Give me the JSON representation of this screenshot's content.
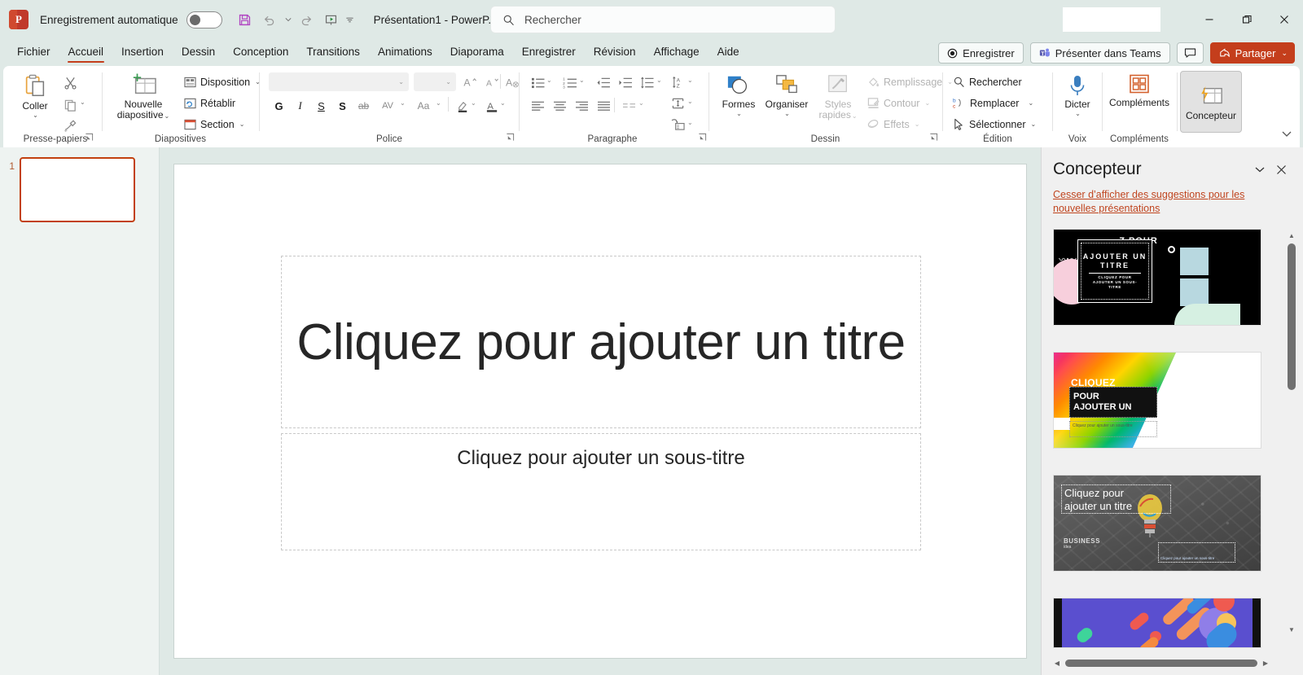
{
  "titlebar": {
    "app_logo": "powerpoint-logo",
    "autosave_label": "Enregistrement automatique",
    "autosave_state": "off",
    "quick_access": [
      {
        "name": "save-icon",
        "label": "Enregistrer"
      },
      {
        "name": "undo-icon",
        "label": "Annuler"
      },
      {
        "name": "redo-icon",
        "label": "Rétablir"
      },
      {
        "name": "start-slideshow-icon",
        "label": "Démarrer à partir du début"
      },
      {
        "name": "customize-qat-icon",
        "label": "Personnaliser la barre d'outils Accès rapide"
      }
    ],
    "document_title": "Présentation1  -  PowerP...",
    "window_controls": {
      "minimize": "–",
      "restore": "❐",
      "close": "✕"
    }
  },
  "search": {
    "placeholder": "Rechercher",
    "icon": "search-icon"
  },
  "tabs": [
    {
      "label": "Fichier",
      "active": false
    },
    {
      "label": "Accueil",
      "active": true
    },
    {
      "label": "Insertion",
      "active": false
    },
    {
      "label": "Dessin",
      "active": false
    },
    {
      "label": "Conception",
      "active": false
    },
    {
      "label": "Transitions",
      "active": false
    },
    {
      "label": "Animations",
      "active": false
    },
    {
      "label": "Diaporama",
      "active": false
    },
    {
      "label": "Enregistrer",
      "active": false
    },
    {
      "label": "Révision",
      "active": false
    },
    {
      "label": "Affichage",
      "active": false
    },
    {
      "label": "Aide",
      "active": false
    }
  ],
  "tab_actions": {
    "record_label": "Enregistrer",
    "teams_label": "Présenter dans Teams",
    "comments_label": "Commentaires",
    "share_label": "Partager"
  },
  "ribbon": {
    "groups": [
      {
        "name": "presse-papiers",
        "label": "Presse-papiers"
      },
      {
        "name": "diapositives",
        "label": "Diapositives"
      },
      {
        "name": "police",
        "label": "Police"
      },
      {
        "name": "paragraphe",
        "label": "Paragraphe"
      },
      {
        "name": "dessin",
        "label": "Dessin"
      },
      {
        "name": "edition",
        "label": "Édition"
      },
      {
        "name": "voix",
        "label": "Voix"
      },
      {
        "name": "complements",
        "label": "Compléments"
      }
    ],
    "clipboard": {
      "paste_label": "Coller",
      "cut_label": "Couper",
      "copy_label": "Copier",
      "format_painter_label": "Reproduire la mise en forme"
    },
    "slides": {
      "new_slide_line1": "Nouvelle",
      "new_slide_line2": "diapositive",
      "layout_label": "Disposition",
      "reset_label": "Rétablir",
      "section_label": "Section"
    },
    "font": {
      "font_name_value": "",
      "font_size_value": "",
      "grow_label": "Augmenter la taille de police",
      "shrink_label": "Diminuer la taille de police",
      "clear_format_label": "Effacer toute la mise en forme",
      "bold_label": "G",
      "italic_label": "I",
      "underline_label": "S",
      "shadow_label": "S",
      "strike_label": "ab",
      "spacing_label": "AV",
      "case_label": "Aa",
      "highlight_label": "Couleur de surbrillance du texte",
      "fontcolor_label": "Couleur de police"
    },
    "paragraph": {
      "bullets_label": "Puces",
      "numbering_label": "Numérotation",
      "decrease_indent_label": "Diminuer le retrait",
      "increase_indent_label": "Augmenter le retrait",
      "line_spacing_label": "Interligne",
      "align_left_label": "Aligner à gauche",
      "align_center_label": "Centrer",
      "align_right_label": "Aligner à droite",
      "justify_label": "Justifier",
      "columns_label": "Colonnes",
      "text_direction_label": "Orientation du texte",
      "align_text_label": "Aligner le texte",
      "smartart_label": "Convertir en SmartArt"
    },
    "drawing": {
      "shapes_label": "Formes",
      "arrange_label": "Organiser",
      "quickstyles_line1": "Styles",
      "quickstyles_line2": "rapides",
      "fill_label": "Remplissage",
      "outline_label": "Contour",
      "effects_label": "Effets"
    },
    "editing": {
      "find_label": "Rechercher",
      "replace_label": "Remplacer",
      "select_label": "Sélectionner"
    },
    "voice": {
      "dictate_label": "Dicter"
    },
    "addins": {
      "addins_label": "Compléments"
    },
    "designer_button": {
      "label": "Concepteur",
      "active": true
    },
    "collapse_label": "Réduire le ruban"
  },
  "slide_panel": {
    "slides": [
      {
        "number": "1",
        "selected": true
      }
    ]
  },
  "slide": {
    "title_placeholder": "Cliquez pour ajouter un titre",
    "subtitle_placeholder": "Cliquez pour ajouter un sous-titre"
  },
  "designer": {
    "title": "Concepteur",
    "collapse_icon": "chevron-down-icon",
    "close_icon": "close-icon",
    "stop_link": "Cesser d’afficher des suggestions pour les nouvelles présentations",
    "designs": [
      {
        "name": "design-memphis-black",
        "title_text": "AJOUTER UN TITRE",
        "overflow_text": "Z POUR",
        "subtitle_text": "CLIQUEZ POUR AJOUTER UN SOUS-TITRE",
        "bg_color": "#000000",
        "accent_color": "#f7cfdc"
      },
      {
        "name": "design-rainbow-paint",
        "heading_text": "CLIQUEZ",
        "title_line1": "POUR",
        "title_line2": "AJOUTER UN",
        "subtitle_text": "Cliquez pour ajouter un sous-titre",
        "bg_color": "#ffffff",
        "accent_color": "#e8107a"
      },
      {
        "name": "design-lightbulb-chalkboard",
        "title_line1": "Cliquez pour",
        "title_line2": "ajouter un titre",
        "subtitle_text": "Cliquez pour ajouter un sous-titre",
        "watermark_text": "BUSINESS",
        "watermark_sub": "idea",
        "bg_color": "#5c5c5c"
      },
      {
        "name": "design-purple-shapes",
        "bg_color": "#5a4fcf",
        "accent_color": "#ff7043"
      }
    ],
    "scroll": {
      "up_arrow": "▲",
      "down_arrow": "▼",
      "left_arrow": "◀",
      "right_arrow": "▶"
    }
  },
  "colors": {
    "app_chrome": "#dfe9e6",
    "brand_red": "#c43e1c",
    "ribbon_bg": "#ffffff",
    "selection_orange": "#c2400f",
    "designer_panel": "#f0f0f0"
  }
}
